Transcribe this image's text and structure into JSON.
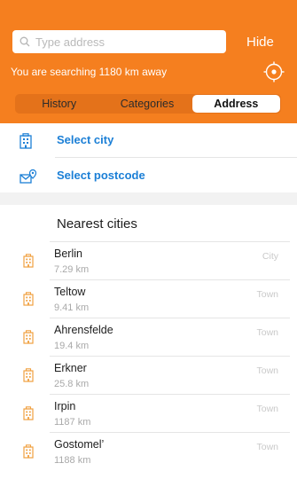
{
  "colors": {
    "accent": "#f57f1f",
    "link": "#1b7fd6",
    "city_icon": "#f0a040"
  },
  "header": {
    "search_placeholder": "Type address",
    "hide_label": "Hide",
    "distance_text": "You are searching 1180 km away",
    "tabs": [
      {
        "label": "History",
        "active": false
      },
      {
        "label": "Categories",
        "active": false
      },
      {
        "label": "Address",
        "active": true
      }
    ]
  },
  "actions": {
    "select_city": "Select city",
    "select_postcode": "Select postcode"
  },
  "nearest": {
    "title": "Nearest cities",
    "cities": [
      {
        "name": "Berlin",
        "distance": "7.29 km",
        "type": "City"
      },
      {
        "name": "Teltow",
        "distance": "9.41 km",
        "type": "Town"
      },
      {
        "name": "Ahrensfelde",
        "distance": "19.4 km",
        "type": "Town"
      },
      {
        "name": "Erkner",
        "distance": "25.8 km",
        "type": "Town"
      },
      {
        "name": "Irpin",
        "distance": "1187 km",
        "type": "Town"
      },
      {
        "name": "Gostomel’",
        "distance": "1188 km",
        "type": "Town"
      }
    ]
  }
}
